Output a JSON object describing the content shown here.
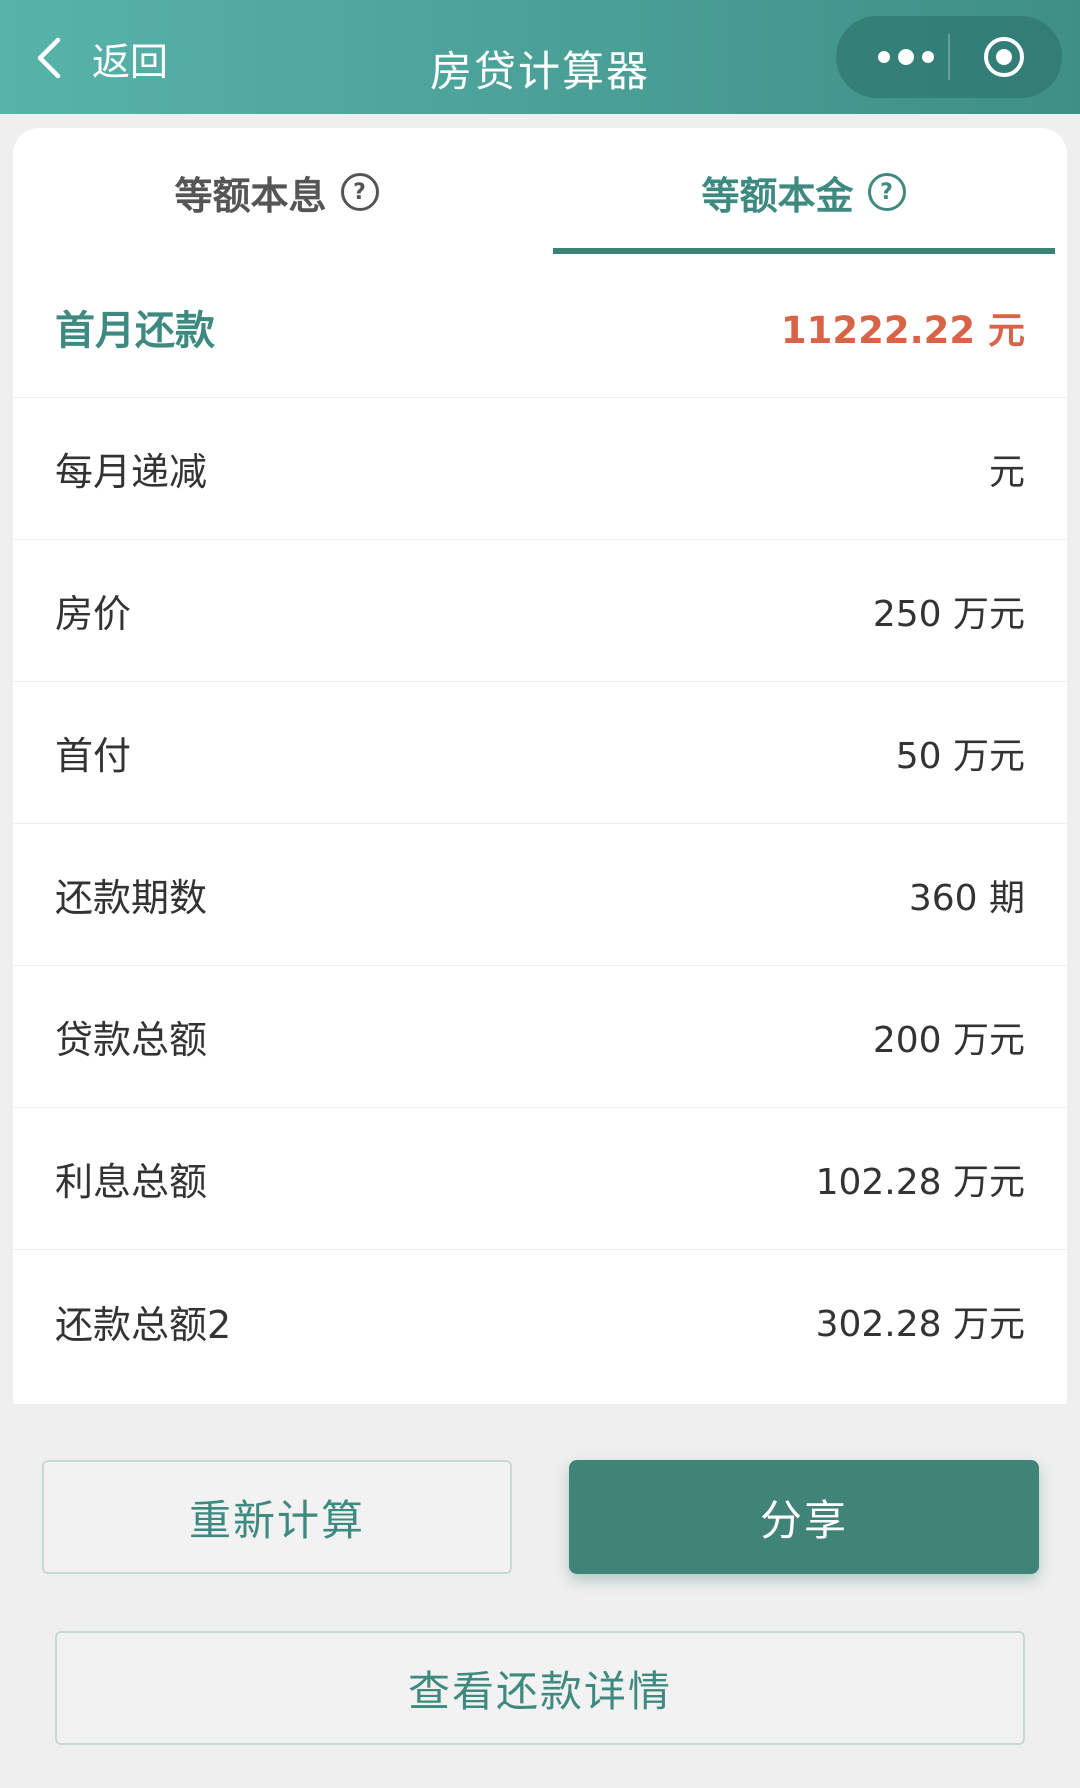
{
  "header": {
    "back_label": "返回",
    "title": "房贷计算器",
    "more_icon": "more-dots-icon",
    "close_icon": "target-icon"
  },
  "tabs": [
    {
      "label": "等额本息",
      "active": false
    },
    {
      "label": "等额本金",
      "active": true
    }
  ],
  "help_icon_glyph": "?",
  "rows": [
    {
      "label": "首月还款",
      "value": "11222.22 元"
    },
    {
      "label": "每月递减",
      "value": "元"
    },
    {
      "label": "房价",
      "value": "250 万元"
    },
    {
      "label": "首付",
      "value": "50 万元"
    },
    {
      "label": "还款期数",
      "value": "360 期"
    },
    {
      "label": "贷款总额",
      "value": "200 万元"
    },
    {
      "label": "利息总额",
      "value": "102.28 万元"
    },
    {
      "label": "还款总额2",
      "value": "302.28 万元"
    }
  ],
  "buttons": {
    "recalc": "重新计算",
    "share": "分享",
    "detail": "查看还款详情"
  },
  "colors": {
    "brand": "#3e8a80",
    "highlight": "#d86448"
  }
}
